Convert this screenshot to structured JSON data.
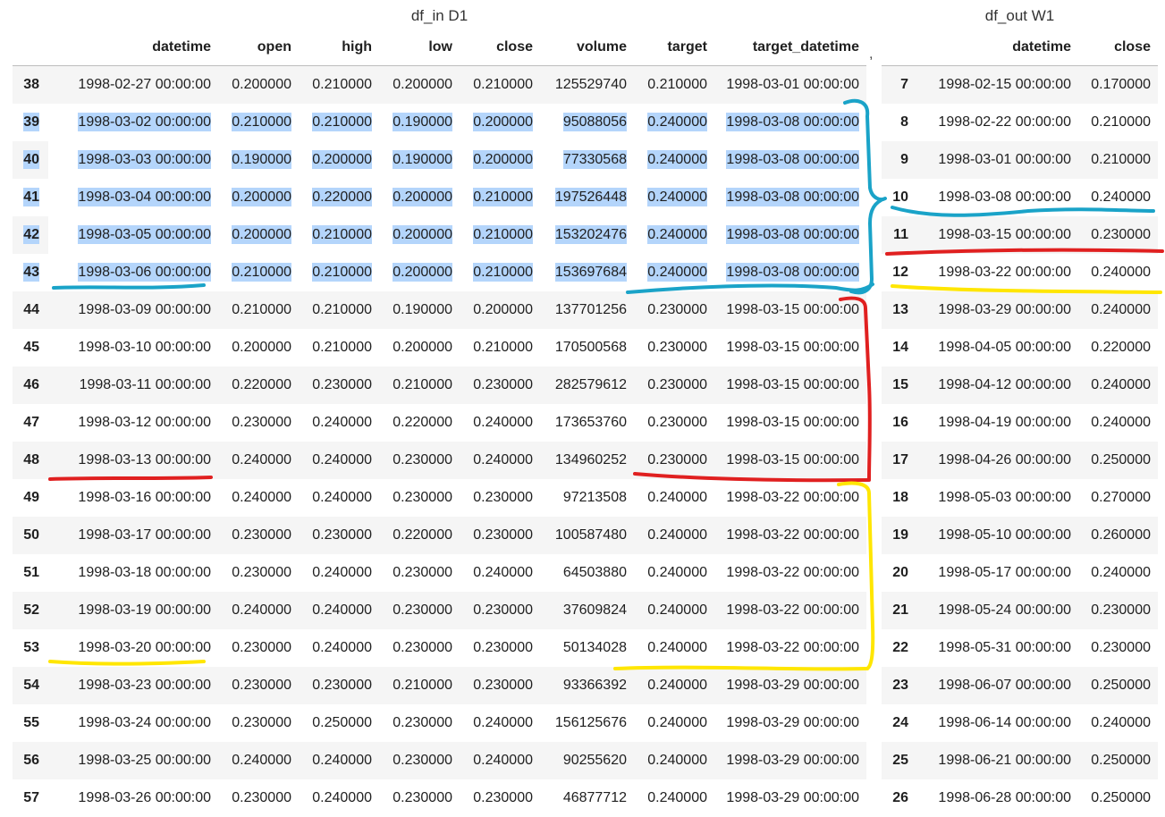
{
  "df_in": {
    "caption": "df_in D1",
    "columns": [
      "",
      "datetime",
      "open",
      "high",
      "low",
      "close",
      "volume",
      "target",
      "target_datetime"
    ],
    "rows": [
      [
        "38",
        "1998-02-27 00:00:00",
        "0.200000",
        "0.210000",
        "0.200000",
        "0.210000",
        "125529740",
        "0.210000",
        "1998-03-01 00:00:00"
      ],
      [
        "39",
        "1998-03-02 00:00:00",
        "0.210000",
        "0.210000",
        "0.190000",
        "0.200000",
        "95088056",
        "0.240000",
        "1998-03-08 00:00:00"
      ],
      [
        "40",
        "1998-03-03 00:00:00",
        "0.190000",
        "0.200000",
        "0.190000",
        "0.200000",
        "77330568",
        "0.240000",
        "1998-03-08 00:00:00"
      ],
      [
        "41",
        "1998-03-04 00:00:00",
        "0.200000",
        "0.220000",
        "0.200000",
        "0.210000",
        "197526448",
        "0.240000",
        "1998-03-08 00:00:00"
      ],
      [
        "42",
        "1998-03-05 00:00:00",
        "0.200000",
        "0.210000",
        "0.200000",
        "0.210000",
        "153202476",
        "0.240000",
        "1998-03-08 00:00:00"
      ],
      [
        "43",
        "1998-03-06 00:00:00",
        "0.210000",
        "0.210000",
        "0.200000",
        "0.210000",
        "153697684",
        "0.240000",
        "1998-03-08 00:00:00"
      ],
      [
        "44",
        "1998-03-09 00:00:00",
        "0.210000",
        "0.210000",
        "0.190000",
        "0.200000",
        "137701256",
        "0.230000",
        "1998-03-15 00:00:00"
      ],
      [
        "45",
        "1998-03-10 00:00:00",
        "0.200000",
        "0.210000",
        "0.200000",
        "0.210000",
        "170500568",
        "0.230000",
        "1998-03-15 00:00:00"
      ],
      [
        "46",
        "1998-03-11 00:00:00",
        "0.220000",
        "0.230000",
        "0.210000",
        "0.230000",
        "282579612",
        "0.230000",
        "1998-03-15 00:00:00"
      ],
      [
        "47",
        "1998-03-12 00:00:00",
        "0.230000",
        "0.240000",
        "0.220000",
        "0.240000",
        "173653760",
        "0.230000",
        "1998-03-15 00:00:00"
      ],
      [
        "48",
        "1998-03-13 00:00:00",
        "0.240000",
        "0.240000",
        "0.230000",
        "0.240000",
        "134960252",
        "0.230000",
        "1998-03-15 00:00:00"
      ],
      [
        "49",
        "1998-03-16 00:00:00",
        "0.240000",
        "0.240000",
        "0.230000",
        "0.230000",
        "97213508",
        "0.240000",
        "1998-03-22 00:00:00"
      ],
      [
        "50",
        "1998-03-17 00:00:00",
        "0.230000",
        "0.230000",
        "0.220000",
        "0.230000",
        "100587480",
        "0.240000",
        "1998-03-22 00:00:00"
      ],
      [
        "51",
        "1998-03-18 00:00:00",
        "0.230000",
        "0.240000",
        "0.230000",
        "0.240000",
        "64503880",
        "0.240000",
        "1998-03-22 00:00:00"
      ],
      [
        "52",
        "1998-03-19 00:00:00",
        "0.240000",
        "0.240000",
        "0.230000",
        "0.230000",
        "37609824",
        "0.240000",
        "1998-03-22 00:00:00"
      ],
      [
        "53",
        "1998-03-20 00:00:00",
        "0.230000",
        "0.240000",
        "0.230000",
        "0.230000",
        "50134028",
        "0.240000",
        "1998-03-22 00:00:00"
      ],
      [
        "54",
        "1998-03-23 00:00:00",
        "0.230000",
        "0.230000",
        "0.210000",
        "0.230000",
        "93366392",
        "0.240000",
        "1998-03-29 00:00:00"
      ],
      [
        "55",
        "1998-03-24 00:00:00",
        "0.230000",
        "0.250000",
        "0.230000",
        "0.240000",
        "156125676",
        "0.240000",
        "1998-03-29 00:00:00"
      ],
      [
        "56",
        "1998-03-25 00:00:00",
        "0.240000",
        "0.240000",
        "0.230000",
        "0.240000",
        "90255620",
        "0.240000",
        "1998-03-29 00:00:00"
      ],
      [
        "57",
        "1998-03-26 00:00:00",
        "0.230000",
        "0.240000",
        "0.230000",
        "0.230000",
        "46877712",
        "0.240000",
        "1998-03-29 00:00:00"
      ]
    ],
    "selected_rows": [
      "39",
      "40",
      "41",
      "42",
      "43"
    ]
  },
  "separator": ",",
  "df_out": {
    "caption": "df_out W1",
    "columns": [
      "",
      "datetime",
      "close"
    ],
    "rows": [
      [
        "7",
        "1998-02-15 00:00:00",
        "0.170000"
      ],
      [
        "8",
        "1998-02-22 00:00:00",
        "0.210000"
      ],
      [
        "9",
        "1998-03-01 00:00:00",
        "0.210000"
      ],
      [
        "10",
        "1998-03-08 00:00:00",
        "0.240000"
      ],
      [
        "11",
        "1998-03-15 00:00:00",
        "0.230000"
      ],
      [
        "12",
        "1998-03-22 00:00:00",
        "0.240000"
      ],
      [
        "13",
        "1998-03-29 00:00:00",
        "0.240000"
      ],
      [
        "14",
        "1998-04-05 00:00:00",
        "0.220000"
      ],
      [
        "15",
        "1998-04-12 00:00:00",
        "0.240000"
      ],
      [
        "16",
        "1998-04-19 00:00:00",
        "0.240000"
      ],
      [
        "17",
        "1998-04-26 00:00:00",
        "0.250000"
      ],
      [
        "18",
        "1998-05-03 00:00:00",
        "0.270000"
      ],
      [
        "19",
        "1998-05-10 00:00:00",
        "0.260000"
      ],
      [
        "20",
        "1998-05-17 00:00:00",
        "0.240000"
      ],
      [
        "21",
        "1998-05-24 00:00:00",
        "0.230000"
      ],
      [
        "22",
        "1998-05-31 00:00:00",
        "0.230000"
      ],
      [
        "23",
        "1998-06-07 00:00:00",
        "0.250000"
      ],
      [
        "24",
        "1998-06-14 00:00:00",
        "0.240000"
      ],
      [
        "25",
        "1998-06-21 00:00:00",
        "0.250000"
      ],
      [
        "26",
        "1998-06-28 00:00:00",
        "0.250000"
      ]
    ]
  },
  "annotation_colors": {
    "blue": "#1aa3c8",
    "red": "#e02020",
    "yellow": "#ffe600"
  }
}
